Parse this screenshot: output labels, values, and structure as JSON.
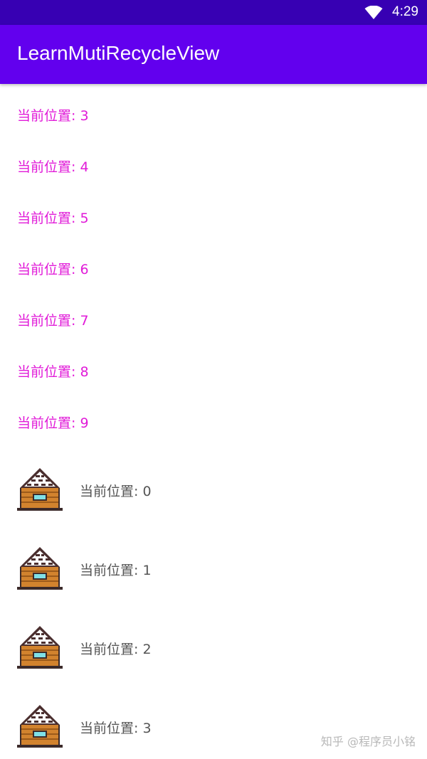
{
  "status_bar": {
    "time": "4:29",
    "wifi_icon": "wifi-icon"
  },
  "app_bar": {
    "title": "LearnMutiRecycleView"
  },
  "text_items": [
    {
      "label": "当前位置: 3"
    },
    {
      "label": "当前位置: 4"
    },
    {
      "label": "当前位置: 5"
    },
    {
      "label": "当前位置: 6"
    },
    {
      "label": "当前位置: 7"
    },
    {
      "label": "当前位置: 8"
    },
    {
      "label": "当前位置: 9"
    }
  ],
  "image_items": [
    {
      "label": "当前位置: 0",
      "icon": "house-icon"
    },
    {
      "label": "当前位置: 1",
      "icon": "house-icon"
    },
    {
      "label": "当前位置: 2",
      "icon": "house-icon"
    },
    {
      "label": "当前位置: 3",
      "icon": "house-icon"
    }
  ],
  "watermark": "知乎 @程序员小铭",
  "colors": {
    "status_bar": "#3700b3",
    "app_bar": "#6200ee",
    "text_item": "#e11ad8",
    "image_item_text": "#555555"
  }
}
